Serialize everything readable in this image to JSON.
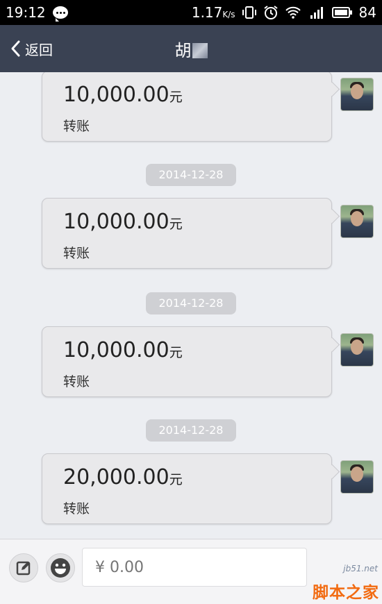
{
  "status_bar": {
    "time": "19:12",
    "network_speed": "1.17",
    "network_unit": "K/s",
    "battery": "84"
  },
  "header": {
    "back_label": "返回",
    "title": "胡"
  },
  "messages": [
    {
      "amount": "10,000.00",
      "currency": "元",
      "kind": "转账"
    },
    {
      "amount": "10,000.00",
      "currency": "元",
      "kind": "转账"
    },
    {
      "amount": "10,000.00",
      "currency": "元",
      "kind": "转账"
    },
    {
      "amount": "20,000.00",
      "currency": "元",
      "kind": "转账"
    }
  ],
  "dates": [
    "2014-12-28",
    "2014-12-28",
    "2014-12-28"
  ],
  "input": {
    "placeholder": "¥ 0.00"
  },
  "watermark": {
    "site": "jb51.net",
    "text": "脚本之家"
  },
  "colors": {
    "header_bg": "#3a4253",
    "chat_bg": "#eceef2",
    "bubble_bg": "#e9e9eb",
    "date_pill": "#cfd0d4",
    "watermark": "#f26b11"
  }
}
